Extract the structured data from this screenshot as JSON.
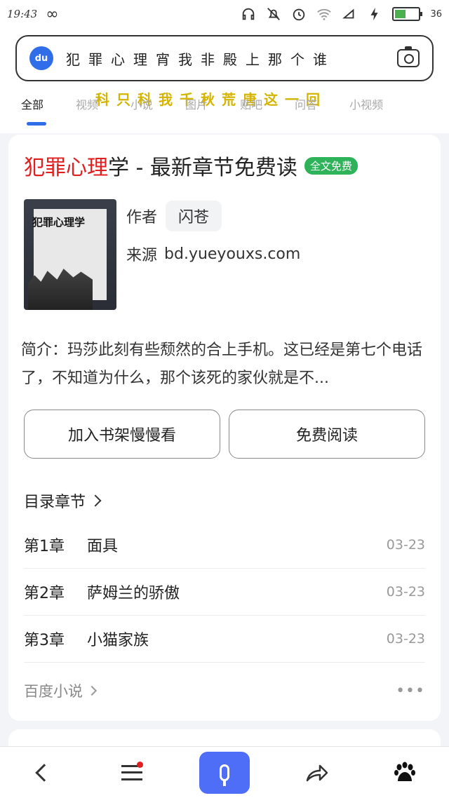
{
  "status_bar": {
    "time": "19:43",
    "battery": "36"
  },
  "search": {
    "query": "犯罪心理宵我非殿上那个谁",
    "overlay": "科只科我千秋荒唐这一回",
    "logo_text": "du"
  },
  "tabs": [
    "全部",
    "视频",
    "小说",
    "图片",
    "贴吧",
    "问答",
    "小视频"
  ],
  "result": {
    "title_highlight": "犯罪心理",
    "title_rest": "学 - 最新章节免费读",
    "badge": "全文免费",
    "cover_title": "犯罪心理学",
    "author_label": "作者",
    "author": "闪苍",
    "source_label": "来源",
    "source": "bd.yueyouxs.com",
    "intro": "简介：玛莎此刻有些颓然的合上手机。这已经是第七个电话了，不知道为什么，那个该死的家伙就是不...",
    "btn_shelf": "加入书架慢慢看",
    "btn_read": "免费阅读",
    "toc_label": "目录章节",
    "chapters": [
      {
        "num": "第1章",
        "name": "面具",
        "date": "03-23"
      },
      {
        "num": "第2章",
        "name": "萨姆兰的骄傲",
        "date": "03-23"
      },
      {
        "num": "第3章",
        "name": "小猫家族",
        "date": "03-23"
      }
    ],
    "footer_source": "百度小说",
    "more": "•••"
  },
  "bottom_bar": {
    "share_icon": "share-icon",
    "paw_icon": "baidu-paw-icon"
  }
}
